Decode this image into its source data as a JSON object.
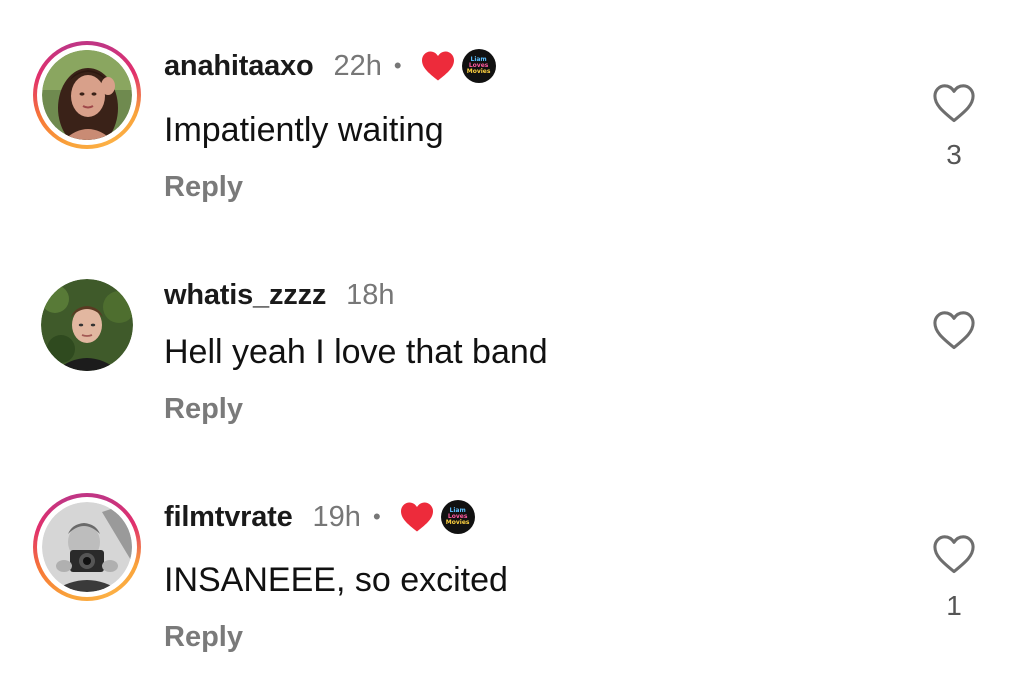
{
  "comments": [
    {
      "username": "anahitaaxo",
      "time": "22h",
      "dot": "•",
      "text": "Impatiently waiting",
      "reply": "Reply",
      "like_count": "3",
      "creator_liked": true,
      "has_story_ring": true,
      "badge_lines": [
        "Liam",
        "Loves",
        "Movies"
      ]
    },
    {
      "username": "whatis_zzzz",
      "time": "18h",
      "text": "Hell yeah I love that band",
      "reply": "Reply",
      "creator_liked": false,
      "has_story_ring": false
    },
    {
      "username": "filmtvrate",
      "time": "19h",
      "dot": "•",
      "text": "INSANEEE, so excited",
      "reply": "Reply",
      "like_count": "1",
      "creator_liked": true,
      "has_story_ring": true,
      "badge_lines": [
        "Liam",
        "Loves",
        "Movies"
      ]
    }
  ],
  "colors": {
    "liked_heart": "#ed2b3b",
    "reply_text": "#7a7a7a",
    "time_text": "#777777",
    "story_ring_start": "#f9a33a",
    "story_ring_end": "#c13584"
  },
  "icons": {
    "like": "heart-outline-icon",
    "creator_like": "heart-filled-icon",
    "creator_badge": "creator-avatar-icon"
  }
}
